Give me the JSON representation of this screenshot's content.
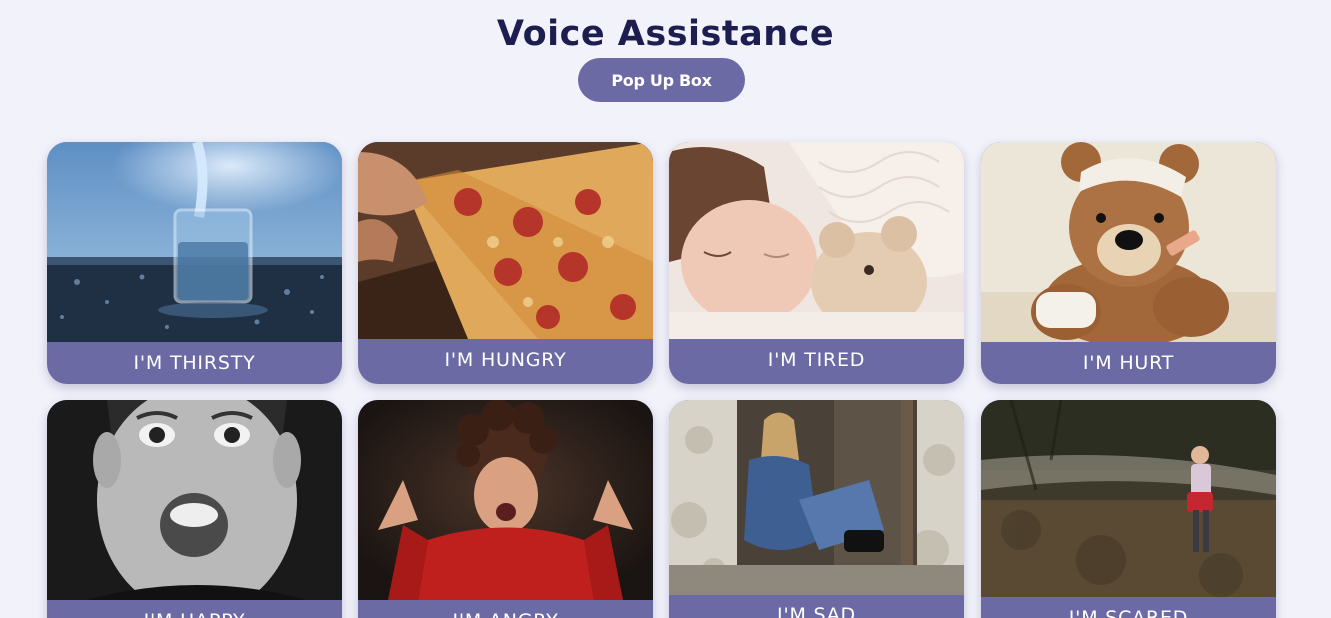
{
  "header": {
    "title": "Voice Assistance",
    "popup_button_label": "Pop Up Box"
  },
  "cards": [
    {
      "label": "I'M THIRSTY",
      "image": "glass-of-water"
    },
    {
      "label": "I'M HUNGRY",
      "image": "pizza-slice"
    },
    {
      "label": "I'M TIRED",
      "image": "sleeping-child"
    },
    {
      "label": "I'M HURT",
      "image": "bandaged-teddy-bear"
    },
    {
      "label": "I'M HAPPY",
      "image": "excited-boy"
    },
    {
      "label": "I'M ANGRY",
      "image": "screaming-boy"
    },
    {
      "label": "I'M SAD",
      "image": "sad-girl-in-doorway"
    },
    {
      "label": "I'M SCARED",
      "image": "girl-in-forest"
    }
  ],
  "colors": {
    "background": "#f2f2fb",
    "title": "#1d1d4f",
    "accent": "#6b6aa5",
    "label_text": "#ffffff"
  }
}
